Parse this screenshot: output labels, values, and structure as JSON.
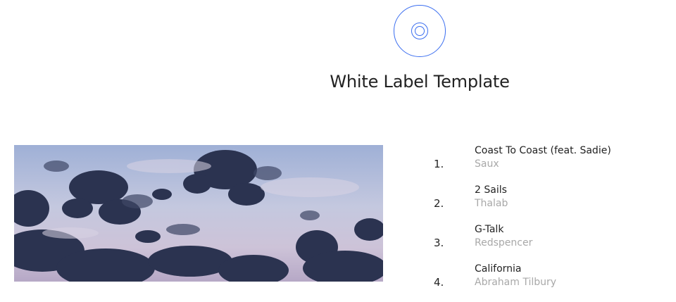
{
  "header": {
    "logo_icon": "disc-icon",
    "title": "White Label Template",
    "accent_color": "#3b6ef0"
  },
  "cover": {
    "image": "sky-clouds-photo"
  },
  "tracks": [
    {
      "number": "1.",
      "title": "Coast To Coast (feat. Sadie)",
      "artist": "Saux"
    },
    {
      "number": "2.",
      "title": "2 Sails",
      "artist": "Thalab"
    },
    {
      "number": "3.",
      "title": "G-Talk",
      "artist": "Redspencer"
    },
    {
      "number": "4.",
      "title": "California",
      "artist": "Abraham Tilbury"
    }
  ]
}
